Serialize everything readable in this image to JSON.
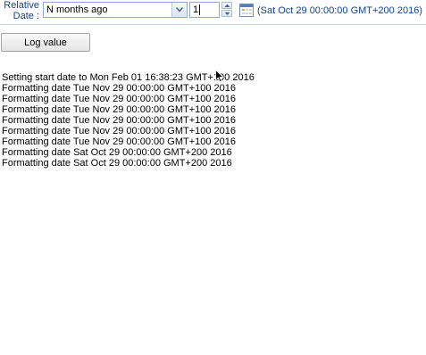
{
  "toolbar": {
    "label_line1": "Relative",
    "label_line2": "Date :",
    "unit_select": {
      "value": "N months ago"
    },
    "amount_spinner": {
      "value": "1"
    },
    "resolved_date": "(Sat Oct 29 00:00:00 GMT+200 2016)"
  },
  "actions": {
    "log_button_label": "Log value"
  },
  "log": {
    "lines": [
      "Setting start date to Mon Feb 01 16:38:23 GMT+100 2016",
      "Formatting date Tue Nov 29 00:00:00 GMT+100 2016",
      "Formatting date Tue Nov 29 00:00:00 GMT+100 2016",
      "Formatting date Tue Nov 29 00:00:00 GMT+100 2016",
      "Formatting date Tue Nov 29 00:00:00 GMT+100 2016",
      "Formatting date Tue Nov 29 00:00:00 GMT+100 2016",
      "Formatting date Tue Nov 29 00:00:00 GMT+100 2016",
      "Formatting date Sat Oct 29 00:00:00 GMT+200 2016",
      "Formatting date Sat Oct 29 00:00:00 GMT+200 2016"
    ]
  },
  "icons": {
    "dropdown": "chevron-down-icon",
    "spin_up": "triangle-up-icon",
    "spin_down": "triangle-down-icon",
    "calendar": "calendar-icon",
    "cursor": "mouse-pointer-icon"
  },
  "colors": {
    "label_text": "#15428b",
    "field_border": "#8faacf"
  }
}
